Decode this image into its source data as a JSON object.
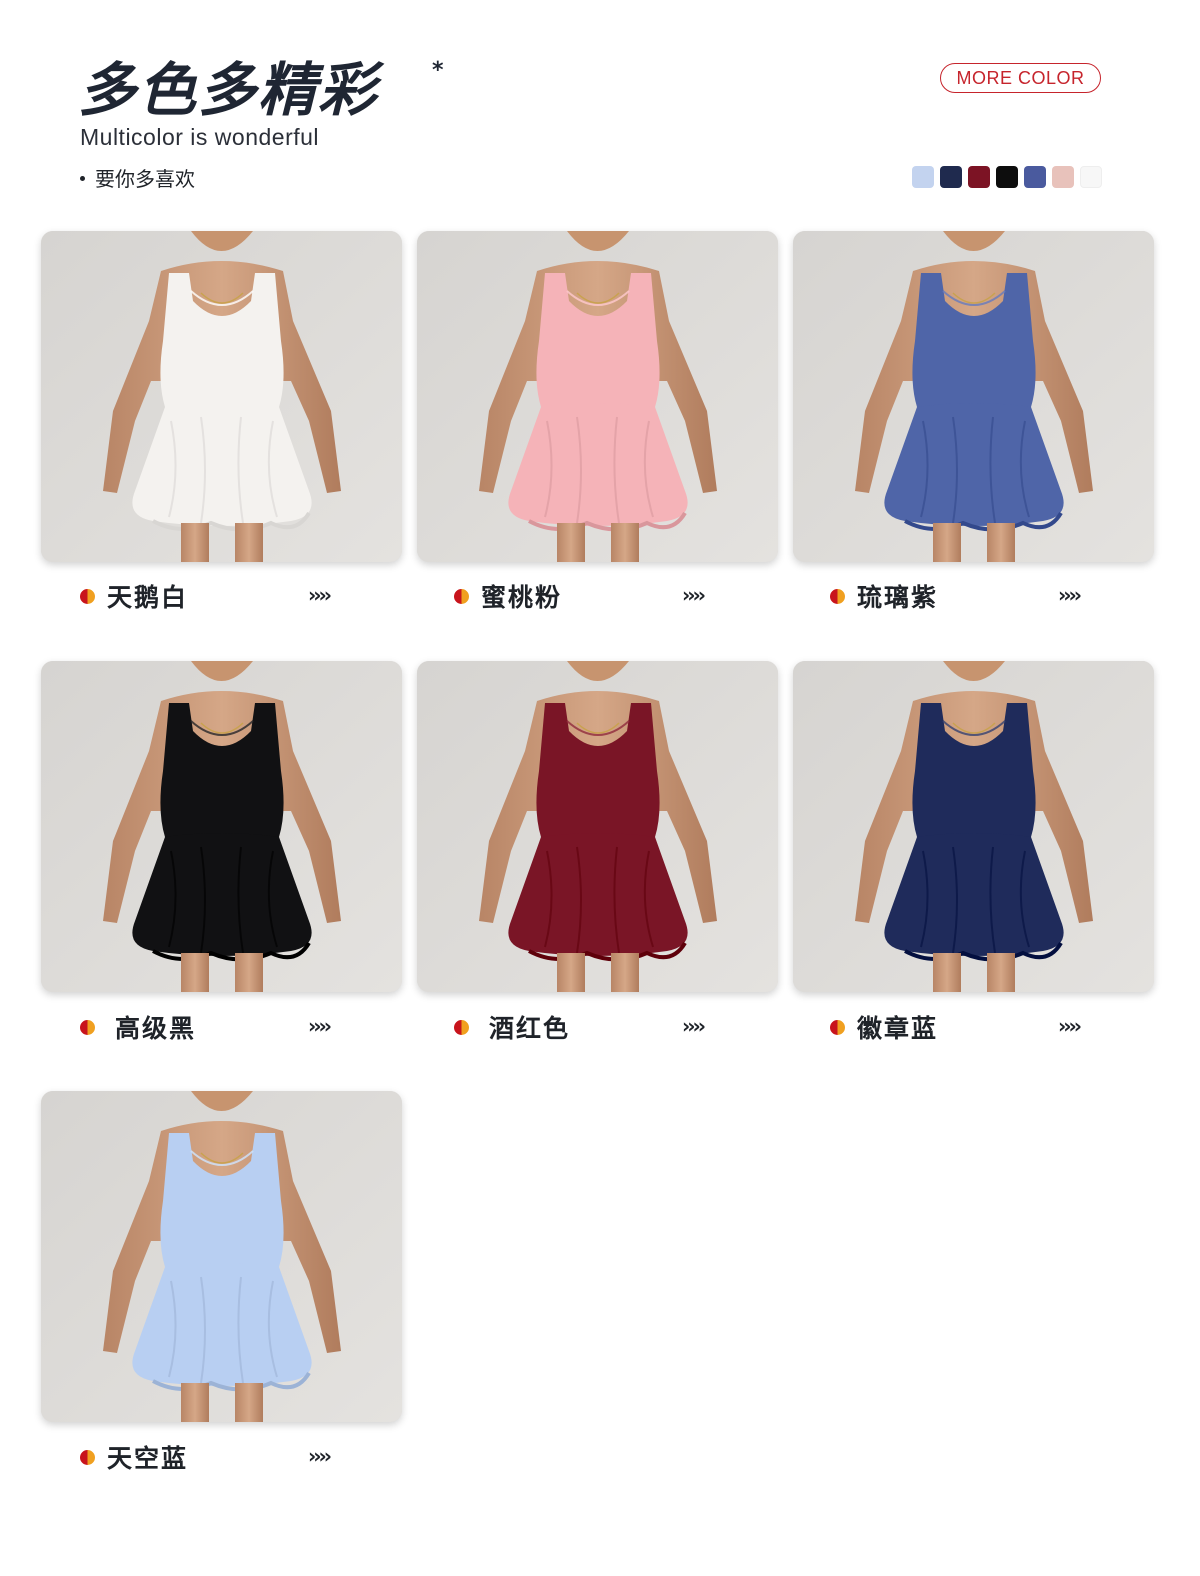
{
  "header": {
    "title": "多色多精彩",
    "title_mark": "*",
    "subtitle": "Multicolor is wonderful",
    "slogan": "要你多喜欢",
    "more_button": "MORE COLOR"
  },
  "swatches": [
    "#c3d3ef",
    "#1f2a4e",
    "#7c1324",
    "#0d0d0d",
    "#4a5a9e",
    "#e8c2bb",
    "#f7f7f7"
  ],
  "accent_color": "#c6242c",
  "products": [
    {
      "name": "天鹅白",
      "color": "#f4f2ef",
      "arrow": "››››"
    },
    {
      "name": "蜜桃粉",
      "color": "#f5b3b8",
      "arrow": "››››"
    },
    {
      "name": "琉璃紫",
      "color": "#4f65a8",
      "arrow": "››››"
    },
    {
      "name": "高级黑",
      "color": "#111113",
      "arrow": "››››"
    },
    {
      "name": "酒红色",
      "color": "#7a1526",
      "arrow": "››››"
    },
    {
      "name": "徽章蓝",
      "color": "#1f2b5b",
      "arrow": "››››"
    },
    {
      "name": "天空蓝",
      "color": "#b8cff2",
      "arrow": "››››"
    }
  ]
}
